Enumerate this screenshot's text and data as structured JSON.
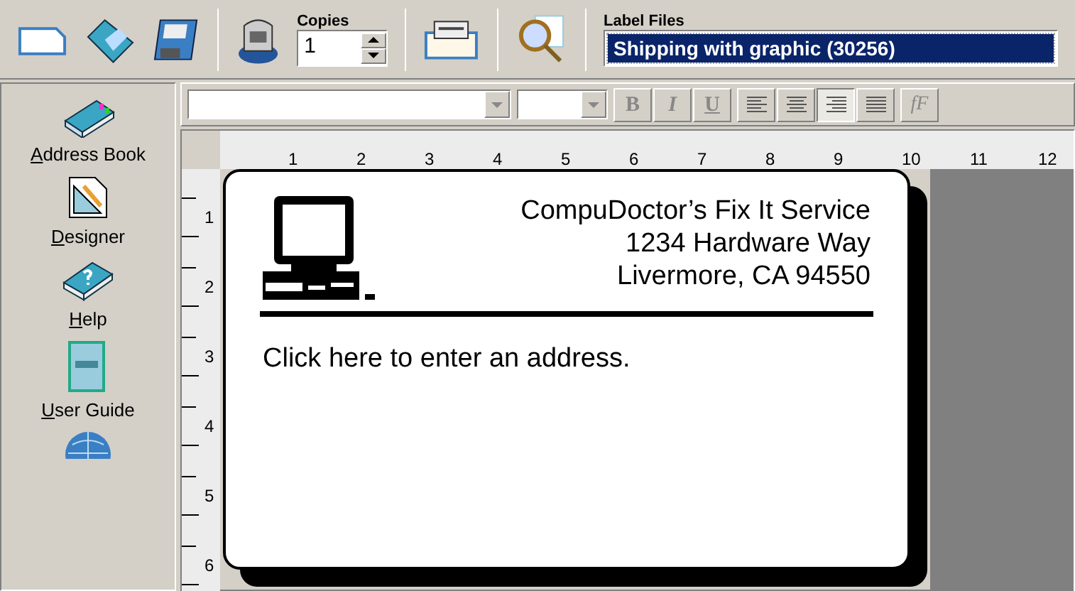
{
  "toolbar": {
    "copies": {
      "label": "Copies",
      "value": "1"
    },
    "label_files": {
      "label": "Label Files",
      "value": "Shipping with graphic (30256)"
    }
  },
  "sidebar": {
    "items": [
      {
        "kind": "address-book",
        "mnemonic": "A",
        "rest": "ddress Book"
      },
      {
        "kind": "designer",
        "mnemonic": "D",
        "rest": "esigner"
      },
      {
        "kind": "help",
        "mnemonic": "H",
        "rest": "elp"
      },
      {
        "kind": "user-guide",
        "mnemonic": "U",
        "rest": "ser Guide"
      },
      {
        "kind": "globe"
      }
    ]
  },
  "format_toolbar": {
    "style_buttons": [
      {
        "kind": "bold",
        "label": "B"
      },
      {
        "kind": "italic",
        "label": "I"
      },
      {
        "kind": "underline",
        "label": "U"
      }
    ],
    "align_buttons": [
      {
        "kind": "left",
        "selected": false
      },
      {
        "kind": "center",
        "selected": false
      },
      {
        "kind": "right",
        "selected": true
      },
      {
        "kind": "justify",
        "selected": false
      }
    ],
    "font_button": "fF"
  },
  "rulers": {
    "horizontal": [
      "1",
      "2",
      "3",
      "4",
      "5",
      "6",
      "7",
      "8",
      "9",
      "10",
      "11",
      "12"
    ],
    "vertical": [
      "1",
      "2",
      "3",
      "4",
      "5",
      "6"
    ]
  },
  "label": {
    "return_address": [
      "CompuDoctor’s Fix It Service",
      "1234 Hardware Way",
      "Livermore, CA 94550"
    ],
    "address_prompt": "Click here to enter an address."
  }
}
